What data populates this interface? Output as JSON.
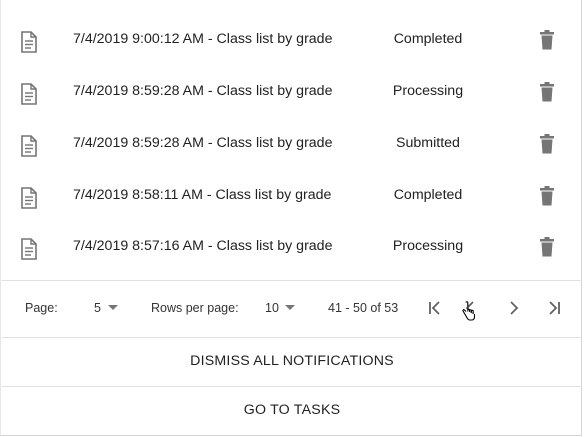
{
  "notifications": [
    {
      "title": "7/4/2019 9:00:12 AM - Class list by grade",
      "status": "Completed"
    },
    {
      "title": "7/4/2019 8:59:28 AM - Class list by grade",
      "status": "Processing"
    },
    {
      "title": "7/4/2019 8:59:28 AM - Class list by grade",
      "status": "Submitted"
    },
    {
      "title": "7/4/2019 8:58:11 AM - Class list by grade",
      "status": "Completed"
    },
    {
      "title": "7/4/2019 8:57:16 AM - Class list by grade",
      "status": "Processing"
    }
  ],
  "pagination": {
    "page_label": "Page:",
    "page_value": "5",
    "rows_label": "Rows per page:",
    "rows_value": "10",
    "range": "41 - 50 of 53"
  },
  "actions": {
    "dismiss_all": "DISMISS ALL NOTIFICATIONS",
    "go_to_tasks": "GO TO TASKS"
  },
  "icons": {
    "row_icon": "document-icon",
    "delete_icon": "trash-icon",
    "first_page": "first-page-icon",
    "prev_page": "chevron-left-icon",
    "next_page": "chevron-right-icon",
    "last_page": "last-page-icon"
  },
  "colors": {
    "icon_gray": "#757575",
    "divider": "#e0e0e0",
    "text": "#212121"
  }
}
